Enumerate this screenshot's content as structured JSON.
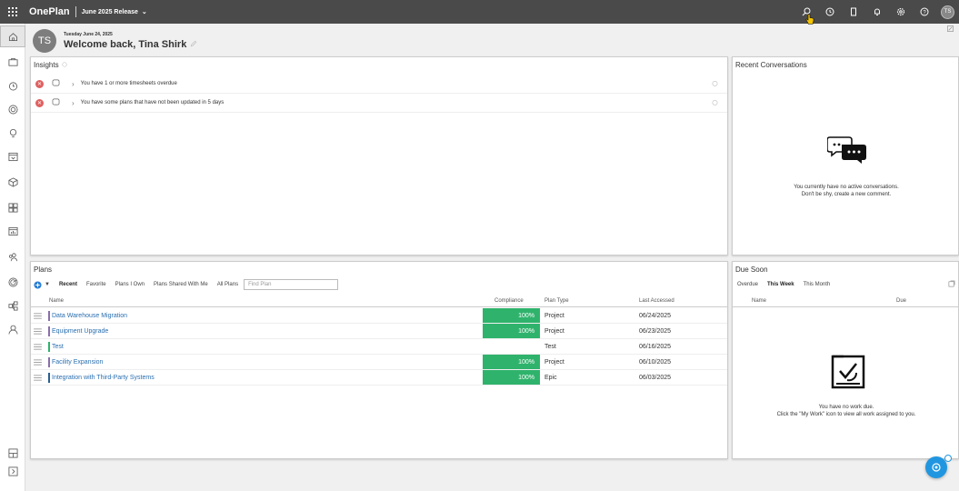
{
  "app": {
    "brand": "OnePlan",
    "release": "June 2025 Release",
    "user_initials": "TS"
  },
  "welcome": {
    "date": "Tuesday June 24, 2025",
    "greeting": "Welcome back, Tina Shirk"
  },
  "insights": {
    "title": "Insights",
    "items": [
      {
        "text": "You have 1 or more timesheets overdue"
      },
      {
        "text": "You have some plans that have not been updated in 5 days"
      }
    ]
  },
  "conversations": {
    "title": "Recent Conversations",
    "empty_line1": "You currently have no active conversations.",
    "empty_line2": "Don't be shy, create a new comment."
  },
  "plans": {
    "title": "Plans",
    "tabs": [
      "Recent",
      "Favorite",
      "Plans I Own",
      "Plans Shared With Me",
      "All Plans"
    ],
    "active_tab": "Recent",
    "search_placeholder": "Find Plan",
    "columns": {
      "name": "Name",
      "compliance": "Compliance",
      "type": "Plan Type",
      "accessed": "Last Accessed"
    },
    "rows": [
      {
        "name": "Data Warehouse Migration",
        "compliance": "100%",
        "type": "Project",
        "accessed": "06/24/2025",
        "color": "#8a6fa8"
      },
      {
        "name": "Equipment Upgrade",
        "compliance": "100%",
        "type": "Project",
        "accessed": "06/23/2025",
        "color": "#8a6fa8"
      },
      {
        "name": "Test",
        "compliance": "",
        "type": "Test",
        "accessed": "06/16/2025",
        "color": "#2fb36c"
      },
      {
        "name": "Facility Expansion",
        "compliance": "100%",
        "type": "Project",
        "accessed": "06/10/2025",
        "color": "#8a6fa8"
      },
      {
        "name": "Integration with Third-Party Systems",
        "compliance": "100%",
        "type": "Epic",
        "accessed": "06/03/2025",
        "color": "#2a5f8f"
      }
    ]
  },
  "due_soon": {
    "title": "Due Soon",
    "tabs": [
      "Overdue",
      "This Week",
      "This Month"
    ],
    "active_tab": "This Week",
    "columns": {
      "name": "Name",
      "due": "Due"
    },
    "empty_line1": "You have no work due.",
    "empty_line2": "Click the \"My Work\" icon to view all work assigned to you."
  },
  "colors": {
    "topbar": "#4a4a4a",
    "compliance_green": "#2fb36c",
    "link": "#2a6fb0",
    "error": "#e06060",
    "fab": "#2196e0"
  }
}
